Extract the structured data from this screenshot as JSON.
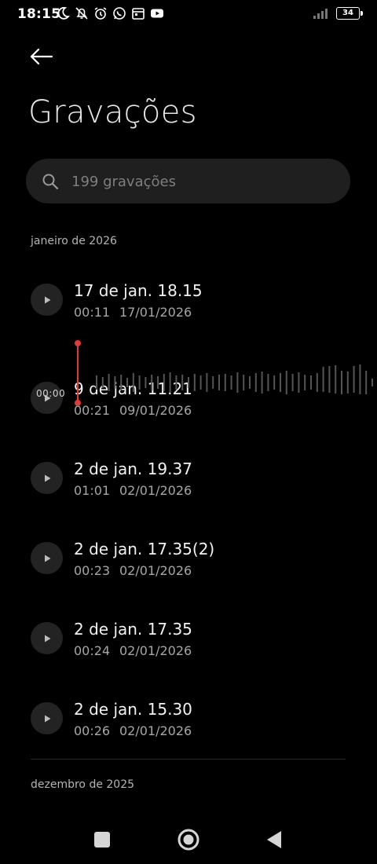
{
  "status": {
    "time": "18:15",
    "battery": "34"
  },
  "header": {
    "title": "Gravações"
  },
  "search": {
    "placeholder": "199 gravações"
  },
  "sections": {
    "first": "janeiro de 2026",
    "second": "dezembro de 2025"
  },
  "recordings": [
    {
      "name": "17 de jan. 18.15",
      "duration": "00:11",
      "date": "17/01/2026"
    },
    {
      "name": "9 de jan. 11.21",
      "duration": "00:21",
      "date": "09/01/2026"
    },
    {
      "name": "2 de jan. 19.37",
      "duration": "01:01",
      "date": "02/01/2026"
    },
    {
      "name": "2 de jan. 17.35(2)",
      "duration": "00:23",
      "date": "02/01/2026"
    },
    {
      "name": "2 de jan. 17.35",
      "duration": "00:24",
      "date": "02/01/2026"
    },
    {
      "name": "2 de jan. 15.30",
      "duration": "00:26",
      "date": "02/01/2026"
    }
  ],
  "playback": {
    "position": "00:00"
  },
  "icons": {
    "back": "arrow-left-icon",
    "search": "search-icon",
    "play": "play-icon",
    "nav": [
      "square-recents-icon",
      "circle-home-icon",
      "triangle-back-icon"
    ]
  },
  "colors": {
    "background": "#000000",
    "search_bg": "#1f1f1f",
    "play_bg": "#232323",
    "cursor": "#e03a3a"
  }
}
